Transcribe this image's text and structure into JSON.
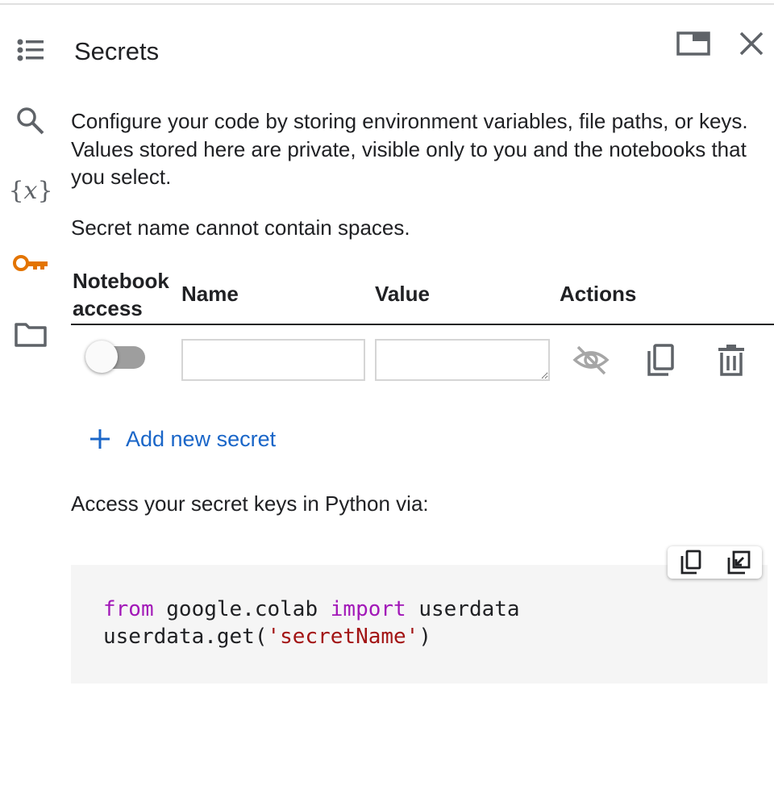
{
  "panel": {
    "title": "Secrets",
    "description": "Configure your code by storing environment variables, file paths, or keys. Values stored here are private, visible only to you and the notebooks that you select.",
    "name_hint": "Secret name cannot contain spaces.",
    "header_buttons": {
      "icons": [
        "open-in-window-icon",
        "close-icon"
      ]
    }
  },
  "sidebar": {
    "items": [
      {
        "icon": "table-of-contents-icon"
      },
      {
        "icon": "search-icon"
      },
      {
        "icon": "variables-icon",
        "glyph": "{𝑥}"
      },
      {
        "icon": "key-icon",
        "active": true
      },
      {
        "icon": "folder-icon"
      }
    ]
  },
  "table": {
    "headers": {
      "notebook_access_line1": "Notebook",
      "notebook_access_line2": "access",
      "name": "Name",
      "value": "Value",
      "actions": "Actions"
    },
    "rows": [
      {
        "notebook_access": false,
        "name": "",
        "value": "",
        "value_visible": false
      }
    ],
    "action_icons": [
      "visibility-off-icon",
      "copy-icon",
      "delete-icon"
    ]
  },
  "add_secret": {
    "label": "Add new secret"
  },
  "access_text": "Access your secret keys in Python via:",
  "code": {
    "line1": {
      "kw1": "from",
      "t1": " google.colab ",
      "kw2": "import",
      "t2": " userdata"
    },
    "line2": {
      "t1": "userdata.get(",
      "str": "'secretName'",
      "t2": ")"
    },
    "tool_icons": [
      "copy-code-icon",
      "insert-into-notebook-icon"
    ]
  },
  "colors": {
    "accent": "#1a66c8",
    "key_icon": "#e37400",
    "keyword": "#a218b8",
    "string": "#a31515",
    "text": "#202124",
    "code_bg": "#f5f5f5"
  }
}
